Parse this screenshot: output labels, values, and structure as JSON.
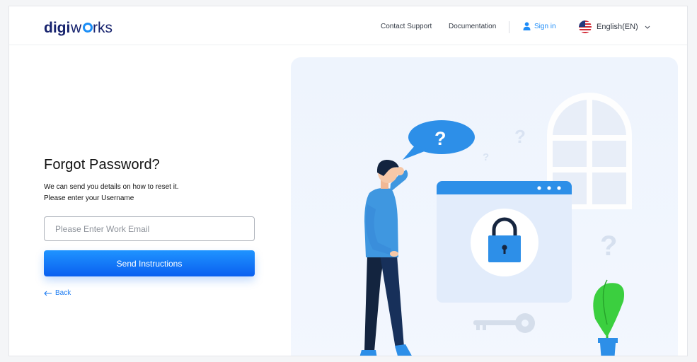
{
  "header": {
    "logo_text": "digiworks",
    "nav": {
      "contact_support": "Contact Support",
      "documentation": "Documentation",
      "sign_in": "Sign in",
      "language": "English(EN)"
    }
  },
  "form": {
    "title": "Forgot Password?",
    "subtitle_line1": "We can send you details on how to reset it.",
    "subtitle_line2": "Please enter your Username",
    "email_placeholder": "Please Enter Work Email",
    "email_value": "",
    "send_label": "Send Instructions",
    "back_label": "Back"
  },
  "colors": {
    "accent": "#1d8cf8",
    "button_top": "#1f94ff",
    "button_bottom": "#0a5ff0",
    "illustration_bg": "#eef4fd"
  },
  "icons": [
    "user-icon",
    "us-flag-icon",
    "chevron-down-icon",
    "arrow-left-icon",
    "padlock-icon",
    "key-icon",
    "question-mark-icon"
  ]
}
